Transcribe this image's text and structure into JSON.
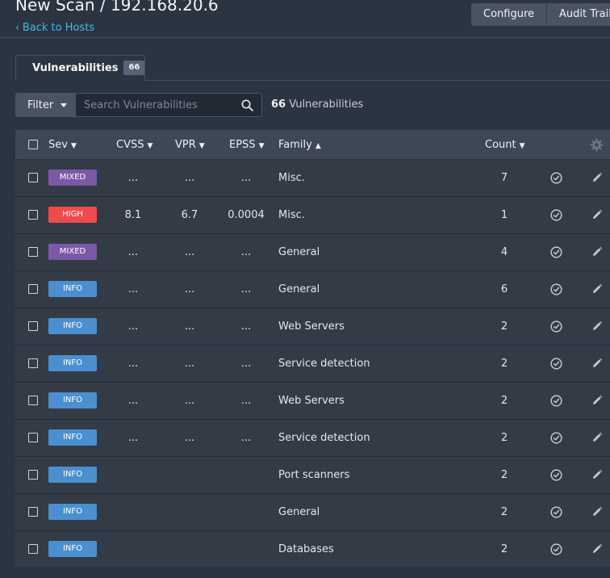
{
  "header": {
    "title": "New Scan / 192.168.20.6",
    "back_link": "Back to Hosts",
    "configure_label": "Configure",
    "audit_trail_label": "Audit Trail"
  },
  "tab": {
    "label": "Vulnerabilities",
    "count": "66"
  },
  "filter": {
    "filter_label": "Filter",
    "search_placeholder": "Search Vulnerabilities",
    "result_count": "66",
    "result_text": "Vulnerabilities"
  },
  "table": {
    "columns": {
      "sev": "Sev",
      "cvss": "CVSS",
      "vpr": "VPR",
      "epss": "EPSS",
      "family": "Family",
      "count": "Count"
    },
    "rows": [
      {
        "sev": "MIXED",
        "cvss": "...",
        "vpr": "...",
        "epss": "...",
        "family": "Misc.",
        "count": "7"
      },
      {
        "sev": "HIGH",
        "cvss": "8.1",
        "vpr": "6.7",
        "epss": "0.0004",
        "family": "Misc.",
        "count": "1"
      },
      {
        "sev": "MIXED",
        "cvss": "...",
        "vpr": "...",
        "epss": "...",
        "family": "General",
        "count": "4"
      },
      {
        "sev": "INFO",
        "cvss": "...",
        "vpr": "...",
        "epss": "...",
        "family": "General",
        "count": "6"
      },
      {
        "sev": "INFO",
        "cvss": "...",
        "vpr": "...",
        "epss": "...",
        "family": "Web Servers",
        "count": "2"
      },
      {
        "sev": "INFO",
        "cvss": "...",
        "vpr": "...",
        "epss": "...",
        "family": "Service detection",
        "count": "2"
      },
      {
        "sev": "INFO",
        "cvss": "...",
        "vpr": "...",
        "epss": "...",
        "family": "Web Servers",
        "count": "2"
      },
      {
        "sev": "INFO",
        "cvss": "...",
        "vpr": "...",
        "epss": "...",
        "family": "Service detection",
        "count": "2"
      },
      {
        "sev": "INFO",
        "cvss": "",
        "vpr": "",
        "epss": "",
        "family": "Port scanners",
        "count": "2"
      },
      {
        "sev": "INFO",
        "cvss": "",
        "vpr": "",
        "epss": "",
        "family": "General",
        "count": "2"
      },
      {
        "sev": "INFO",
        "cvss": "",
        "vpr": "",
        "epss": "",
        "family": "Databases",
        "count": "2"
      }
    ]
  },
  "colors": {
    "MIXED": "#7b59a6",
    "HIGH": "#f04b4b",
    "INFO": "#4a90d0",
    "accent_link": "#49b7e8"
  },
  "icons": {
    "back": "chevron-left-icon",
    "filter_caret": "caret-down-icon",
    "search": "search-icon",
    "settings": "gear-icon",
    "snooze": "clock-check-icon",
    "edit": "pencil-icon"
  }
}
